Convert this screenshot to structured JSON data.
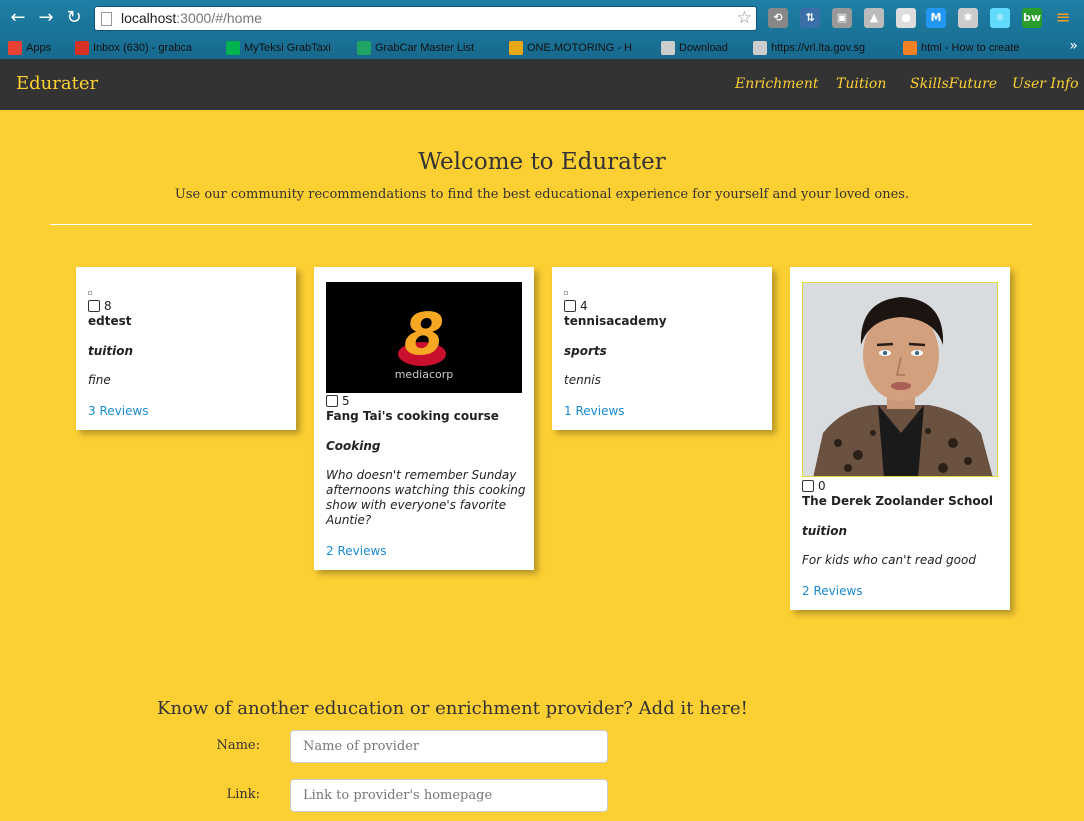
{
  "browser": {
    "url_host": "localhost",
    "url_path": ":3000/#/home",
    "bookmarks": [
      {
        "label": "Apps",
        "icon": "apps-grid-icon",
        "color": "#e94235"
      },
      {
        "label": "Inbox (630) - grabca",
        "icon": "gmail-icon",
        "color": "#d93025"
      },
      {
        "label": "MyTeksi GrabTaxi",
        "icon": "grab-icon",
        "color": "#00b14f"
      },
      {
        "label": "GrabCar Master List",
        "icon": "google-drive-icon",
        "color": "#1fa463"
      },
      {
        "label": "ONE.MOTORING - H",
        "icon": "onemotoring-icon",
        "color": "#e6a817"
      },
      {
        "label": "Download",
        "icon": "page-icon",
        "color": "#cccccc"
      },
      {
        "label": "https://vrl.lta.gov.sg",
        "icon": "page-icon",
        "color": "#cccccc"
      },
      {
        "label": "html - How to create",
        "icon": "stackoverflow-icon",
        "color": "#f48024"
      }
    ],
    "extensions": [
      {
        "name": "extension-recycle-icon",
        "color": "#888888",
        "glyph": "⟲"
      },
      {
        "name": "extension-download-icon",
        "color": "#3a6fa8",
        "glyph": "⇅"
      },
      {
        "name": "extension-tool-icon",
        "color": "#999999",
        "glyph": "▣"
      },
      {
        "name": "extension-drive-icon",
        "color": "#bbbbbb",
        "glyph": "▲"
      },
      {
        "name": "extension-circle-icon",
        "color": "#dddddd",
        "glyph": "●"
      },
      {
        "name": "extension-m-icon",
        "color": "#2196f3",
        "glyph": "M"
      },
      {
        "name": "extension-gear-icon",
        "color": "#cccccc",
        "glyph": "✱"
      },
      {
        "name": "extension-react-icon",
        "color": "#61dafb",
        "glyph": "⚛"
      },
      {
        "name": "extension-bw-icon",
        "color": "#2a9d2a",
        "glyph": "bw"
      }
    ]
  },
  "navbar": {
    "brand": "Edurater",
    "links": [
      "Enrichment",
      "Tuition",
      "SkillsFuture",
      "User Info"
    ]
  },
  "hero": {
    "title": "Welcome to Edurater",
    "subtitle": "Use our community recommendations to find the best educational experience for yourself and your loved ones."
  },
  "cards": [
    {
      "likes": "8",
      "name": "edtest",
      "category": "tuition",
      "description": "fine",
      "reviews": "3 Reviews",
      "image": "broken-image-icon"
    },
    {
      "likes": "5",
      "name": "Fang Tai's cooking course",
      "category": "Cooking",
      "description": "Who doesn't remember Sunday afternoons watching this cooking show with everyone's favorite Auntie?",
      "reviews": "2 Reviews",
      "image": "mediacorp-logo",
      "logo_text": "mediacorp"
    },
    {
      "likes": "4",
      "name": "tennisacademy",
      "category": "sports",
      "description": "tennis",
      "reviews": "1 Reviews",
      "image": "broken-image-icon"
    },
    {
      "likes": "0",
      "name": "The Derek Zoolander School",
      "category": "tuition",
      "description": "For kids who can't read good",
      "reviews": "2 Reviews",
      "image": "zoolander-photo"
    }
  ],
  "form": {
    "title": "Know of another education or enrichment provider? Add it here!",
    "name_label": "Name:",
    "name_placeholder": "Name of provider",
    "link_label": "Link:",
    "link_placeholder": "Link to provider's homepage"
  },
  "colors": {
    "background": "#fccf33",
    "navbar": "#333333",
    "accent": "#fccf33",
    "link": "#1a8ad1"
  }
}
